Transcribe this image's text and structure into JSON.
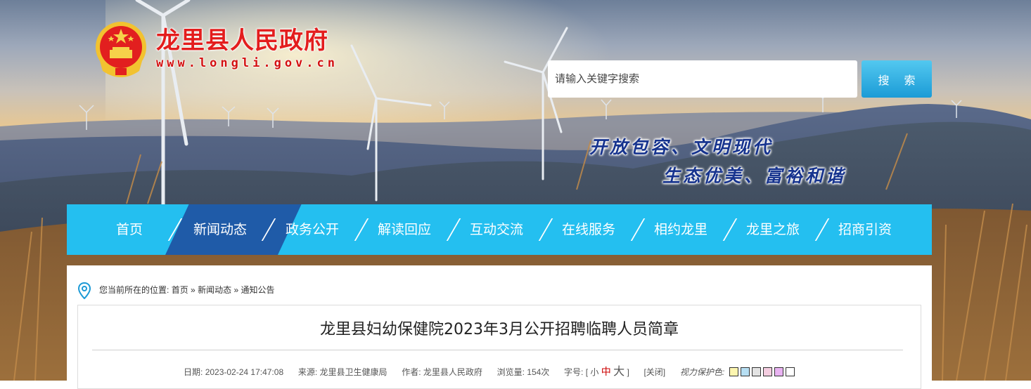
{
  "header": {
    "site_title": "龙里县人民政府",
    "site_url": "www.longli.gov.cn",
    "search_placeholder": "请输入关键字搜索",
    "search_button": "搜 索",
    "slogan_line1": "开放包容、文明现代",
    "slogan_line2": "生态优美、富裕和谐"
  },
  "nav": {
    "active_index": 1,
    "items": [
      "首页",
      "新闻动态",
      "政务公开",
      "解读回应",
      "互动交流",
      "在线服务",
      "相约龙里",
      "龙里之旅",
      "招商引资"
    ]
  },
  "breadcrumb": {
    "prefix": "您当前所在的位置:",
    "items": [
      "首页",
      "新闻动态",
      "通知公告"
    ],
    "separator": "»"
  },
  "article": {
    "title": "龙里县妇幼保健院2023年3月公开招聘临聘人员简章",
    "date_label": "日期:",
    "date": "2023-02-24 17:47:08",
    "source_label": "来源:",
    "source": "龙里县卫生健康局",
    "author_label": "作者:",
    "author": "龙里县人民政府",
    "views_label": "浏览量:",
    "views": "154次",
    "font_size_label": "字号:",
    "font_small": "小",
    "font_medium": "中",
    "font_large": "大",
    "close_label": "[关闭]",
    "vision_label": "视力保护色:",
    "vision_colors": [
      "#fdf6b0",
      "#b7dff3",
      "#e3e3e3",
      "#f4cde0",
      "#e9b3f2",
      "#ffffff"
    ]
  },
  "colors": {
    "nav_bg": "#24bff0",
    "nav_active": "#1f5ba8",
    "title_red": "#e31d1d",
    "slogan_blue": "#16338e"
  }
}
